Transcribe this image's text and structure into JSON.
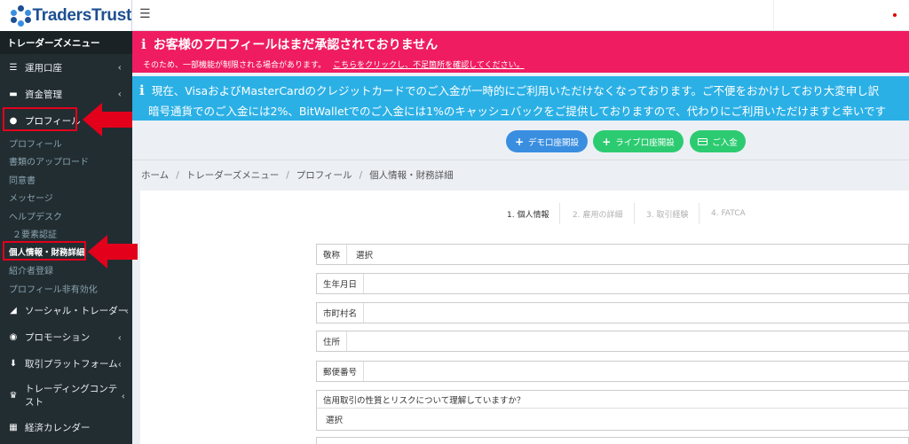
{
  "brand": {
    "logo_text": "TradersTrust"
  },
  "sidebar": {
    "menu_header": "トレーダーズメニュー",
    "trading_accounts": "運用口座",
    "funds": "資金管理",
    "profile": "プロフィール",
    "profile_sub": [
      "プロフィール",
      "書類のアップロード",
      "同意書",
      "メッセージ",
      "ヘルプデスク"
    ],
    "twofa": "２要素認証",
    "personal_financial": "個人情報・財務詳細",
    "referrer": "紹介者登録",
    "deactivate": "プロフィール非有効化",
    "social_trader": "ソーシャル・トレーダー",
    "promotions": "プロモーション",
    "platforms": "取引プラットフォーム",
    "contest": "トレーディングコンテスト",
    "calendar": "経済カレンダー"
  },
  "alert": {
    "title": "お客様のプロフィールはまだ承認されておりません",
    "subtext": "そのため、一部機能が制限される場合があります。",
    "link": "こちらをクリックし、不足箇所を確認してください。"
  },
  "notice": {
    "line1": "現在、VisaおよびMasterCardのクレジットカードでのご入金が一時的にご利用いただけなくなっております。ご不便をおかけしており大変申し訳",
    "line2": "暗号通貨でのご入金には2%、BitWalletでのご入金には1%のキャッシュバックをご提供しておりますので、代わりにご利用いただけますと幸いです"
  },
  "actions": {
    "demo": "デモ口座開設",
    "live": "ライブ口座開設",
    "deposit": "ご入金"
  },
  "breadcrumb": [
    "ホーム",
    "トレーダーズメニュー",
    "プロフィール",
    "個人情報・財務詳細"
  ],
  "steps": [
    "1. 個人情報",
    "2. 雇用の詳細",
    "3. 取引経験",
    "4. FATCA"
  ],
  "form": {
    "title_label": "敬称",
    "title_value": "選択",
    "dob_label": "生年月日",
    "city_label": "市町村名",
    "address_label": "住所",
    "postal_label": "郵便番号",
    "risk_question": "信用取引の性質とリスクについて理解していますか？",
    "risk_value": "選択"
  },
  "colors": {
    "sidebar_bg": "#222d32",
    "alert_pink": "#ef1c62",
    "notice_blue": "#2bb0e6",
    "btn_blue": "#3a8ee0",
    "btn_green": "#2dcb71",
    "highlight_red": "#e3001b"
  }
}
